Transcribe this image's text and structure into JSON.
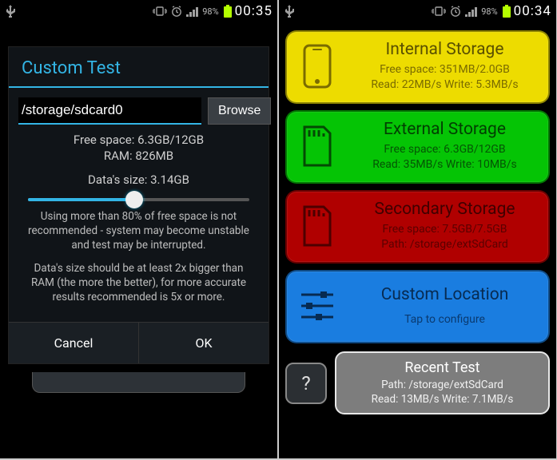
{
  "left": {
    "status": {
      "battery_pct": "98%",
      "time": "00:35"
    },
    "dialog": {
      "title": "Custom Test",
      "path_value": "/storage/sdcard0",
      "browse_label": "Browse",
      "free_space": "Free space: 6.3GB/12GB",
      "ram": "RAM: 826MB",
      "data_size": "Data's size: 3.14GB",
      "advice1": "Using more than 80% of free space is not recommended - system may become unstable and test may be interrupted.",
      "advice2": "Data's size should be at least 2x bigger than RAM (the more the better), for more accurate results recommended is 5x or more.",
      "cancel_label": "Cancel",
      "ok_label": "OK"
    }
  },
  "right": {
    "status": {
      "battery_pct": "98%",
      "time": "00:34"
    },
    "cards": {
      "internal": {
        "title": "Internal Storage",
        "line1": "Free space: 351MB/2.0GB",
        "line2": "Read: 22MB/s Write: 5.3MB/s"
      },
      "external": {
        "title": "External Storage",
        "line1": "Free space: 6.3GB/12GB",
        "line2": "Read: 35MB/s Write: 10MB/s"
      },
      "secondary": {
        "title": "Secondary Storage",
        "line1": "Free space: 7.5GB/7.5GB",
        "line2": "Path: /storage/extSdCard"
      },
      "custom": {
        "title": "Custom Location",
        "line1": "Tap to configure"
      }
    },
    "help_label": "?",
    "recent": {
      "title": "Recent Test",
      "line1": "Path: /storage/extSdCard",
      "line2": "Read: 13MB/s Write: 7.1MB/s"
    }
  }
}
